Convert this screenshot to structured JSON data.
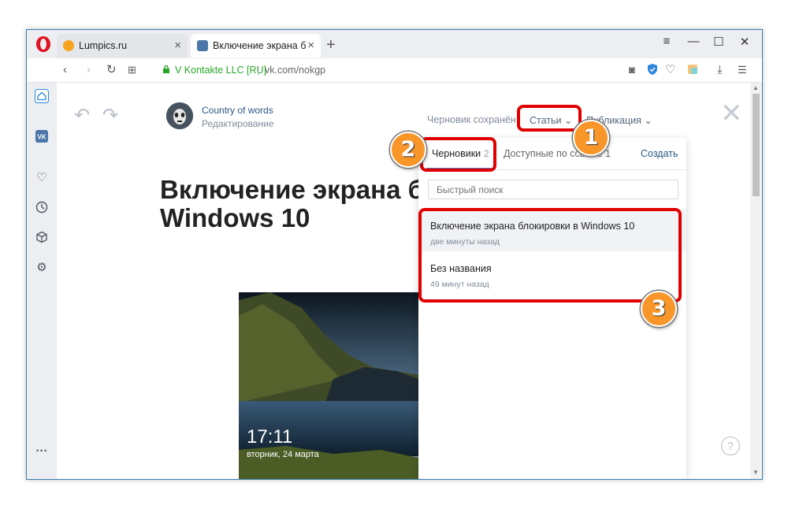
{
  "browser": {
    "tabs": [
      {
        "title": "Lumpics.ru",
        "close": "×"
      },
      {
        "title": "Включение экрана блокир",
        "close": "×"
      }
    ],
    "new_tab": "+",
    "window_controls": {
      "menu": "≡",
      "minimize": "—",
      "maximize": "☐",
      "close": "✕"
    },
    "address": {
      "secure_label": "V Kontakte LLC [RU]",
      "url": "vk.com/nokgp"
    },
    "accent_color": "#3c7fb1"
  },
  "sidebar": {
    "items": [
      {
        "icon": "home-icon"
      },
      {
        "icon": "vk-icon",
        "label": "VK"
      },
      {
        "icon": "heart-icon"
      },
      {
        "icon": "history-clock-icon"
      },
      {
        "icon": "cube-icon"
      },
      {
        "icon": "settings-gear-icon"
      },
      {
        "icon": "more-icon",
        "label": "···"
      }
    ]
  },
  "editor": {
    "author": "Country of words",
    "status": "Редактирование",
    "draft_saved": "Черновик сохранён",
    "articles_button": "Статьи ⌄",
    "publish_button": "Публикация ⌄",
    "article_title_line1": "Включение экрана бл",
    "article_title_line2": "Windows 10",
    "lock_screen_time": "17:11",
    "lock_screen_date": "вторник, 24 марта",
    "help": "?"
  },
  "dropdown": {
    "tab_drafts": "Черновики",
    "tab_drafts_count": "2",
    "tab_shared": "Доступные по ссылке 1",
    "create": "Создать",
    "search_placeholder": "Быстрый поиск",
    "items": [
      {
        "title": "Включение экрана блокировки в Windows 10",
        "time": "две минуты назад"
      },
      {
        "title": "Без названия",
        "time": "49 минут назад"
      }
    ]
  },
  "annotations": {
    "badge1": "1",
    "badge2": "2",
    "badge3": "3",
    "highlight_color": "#e00000",
    "badge_color": "#f9962a"
  }
}
